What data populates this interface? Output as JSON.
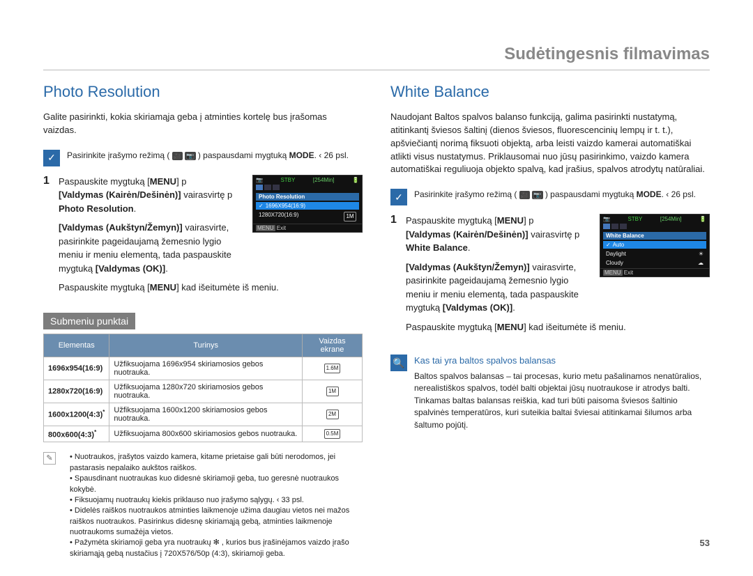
{
  "chapter": "Sudėtingesnis filmavimas",
  "page_number": "53",
  "left": {
    "title": "Photo Resolution",
    "intro": "Galite pasirinkti, kokia skiriamąja geba į atminties kortelę bus įrašomas vaizdas.",
    "note": {
      "text_pre": "Pasirinkite įrašymo režimą (",
      "text_post": ") paspausdami mygtuką",
      "mode": "MODE",
      "mode_after": ". ‹ 26 psl."
    },
    "steps": {
      "s1": {
        "n": "1",
        "t1": "Paspauskite mygtuką [",
        "menu": "MENU",
        "t2": "] p",
        "t3": "[Valdymas (Kairėn/Dešinėn)]",
        "t4": "vairasvirtę p",
        "t5": "Photo Resolution",
        "t6": "."
      },
      "s2": {
        "n": "",
        "t1": "[Valdymas (Aukštyn/Žemyn)]",
        "t2": "vairasvirte, pasirinkite pageidaujamą žemesnio lygio meniu ir meniu elementą, tada paspauskite mygtuką",
        "t3": "[Valdymas (OK)]",
        "t4": "."
      },
      "s3": {
        "n": "",
        "t1": "Paspauskite mygtuką [",
        "menu": "MENU",
        "t2": "] kad išeitumėte iš meniu."
      }
    },
    "lcd": {
      "stby": "STBY",
      "time": "[254Min]",
      "title": "Photo Resolution",
      "sel": "1696X954(16:9)",
      "row1": "1280X720(16:9)",
      "exit_menu": "MENU",
      "exit": "Exit"
    },
    "subtitle": "Submeniu punktai",
    "table": {
      "h1": "Elementas",
      "h2": "Turinys",
      "h3": "Vaizdas ekrane",
      "r1": {
        "e": "1696x954(16:9)",
        "c": "Užfiksuojama 1696x954 skiriamosios gebos nuotrauka.",
        "i": "1.6M"
      },
      "r2": {
        "e": "1280x720(16:9)",
        "c": "Užfiksuojama 1280x720 skiriamosios gebos nuotrauka.",
        "i": "1M"
      },
      "r3": {
        "e": "1600x1200(4:3)",
        "c": "Užfiksuojama 1600x1200 skiriamosios gebos nuotrauka.",
        "i": "2M",
        "star": "*"
      },
      "r4": {
        "e": "800x600(4:3)",
        "c": "Užfiksuojama 800x600 skiriamosios gebos nuotrauka.",
        "i": "0.5M",
        "star": "*"
      }
    },
    "bullets": {
      "b1": "Nuotraukos, įrašytos vaizdo kamera, kitame prietaise gali būti nerodomos, jei pastarasis nepalaiko aukštos raiškos.",
      "b2": "Spausdinant nuotraukas kuo didesnė skiriamoji geba, tuo geresnė nuotraukos kokybė.",
      "b3": "Fiksuojamų nuotraukų kiekis priklauso nuo įrašymo sąlygų. ‹ 33 psl.",
      "b4": "Didelės raiškos nuotraukos atminties laikmenoje užima daugiau vietos nei mažos raiškos nuotraukos. Pasirinkus didesnę skiriamąją gebą, atminties laikmenoje nuotraukoms sumažėja vietos.",
      "b5": "Pažymėta skiriamoji geba yra nuotraukų ✻ , kurios bus įrašinėjamos vaizdo įrašo skiriamąją gebą nustačius į 720X576/50p (4:3), skiriamoji geba."
    }
  },
  "right": {
    "title": "White Balance",
    "intro": "Naudojant Baltos spalvos balanso funkciją, galima pasirinkti nustatymą, atitinkantį šviesos šaltinį (dienos šviesos, fluorescencinių lempų ir t. t.), apšviečiantį norimą fiksuoti objektą, arba leisti vaizdo kamerai automatiškai atlikti visus nustatymus. Priklausomai nuo jūsų pasirinkimo, vaizdo kamera automatiškai reguliuoja objekto spalvą, kad įrašius, spalvos atrodytų natūraliai.",
    "note": {
      "text_pre": "Pasirinkite įrašymo režimą (",
      "text_post": ") paspausdami mygtuką",
      "mode": "MODE",
      "mode_after": ". ‹ 26 psl."
    },
    "steps": {
      "s1": {
        "n": "1",
        "t1": "Paspauskite mygtuką [",
        "menu": "MENU",
        "t2": "] p",
        "t3": "[Valdymas (Kairėn/Dešinėn)]",
        "t4": "vairasvirtę p",
        "t5": "White Balance",
        "t6": "."
      },
      "s2": {
        "n": "",
        "t1": "[Valdymas (Aukštyn/Žemyn)]",
        "t2": "vairasvirte, pasirinkite pageidaujamą žemesnio lygio meniu ir meniu elementą, tada paspauskite mygtuką",
        "t3": "[Valdymas (OK)]",
        "t4": "."
      },
      "s3": {
        "n": "",
        "t1": "Paspauskite mygtuką [",
        "menu": "MENU",
        "t2": "] kad išeitumėte iš meniu."
      }
    },
    "lcd": {
      "stby": "STBY",
      "time": "[254Min]",
      "title": "White Balance",
      "sel": "Auto",
      "row1": "Daylight",
      "row2": "Cloudy",
      "exit_menu": "MENU",
      "exit": "Exit"
    },
    "info": {
      "title": "Kas tai yra baltos spalvos balansas",
      "body": "Baltos spalvos balansas – tai procesas, kurio metu pašalinamos nenatūralios, nerealistiškos spalvos, todėl balti objektai jūsų nuotraukose ir atrodys balti. Tinkamas baltas balansas reiškia, kad turi būti paisoma šviesos šaltinio spalvinės temperatūros, kuri suteikia baltai šviesai atitinkamai šilumos arba šaltumo pojūtį."
    }
  }
}
